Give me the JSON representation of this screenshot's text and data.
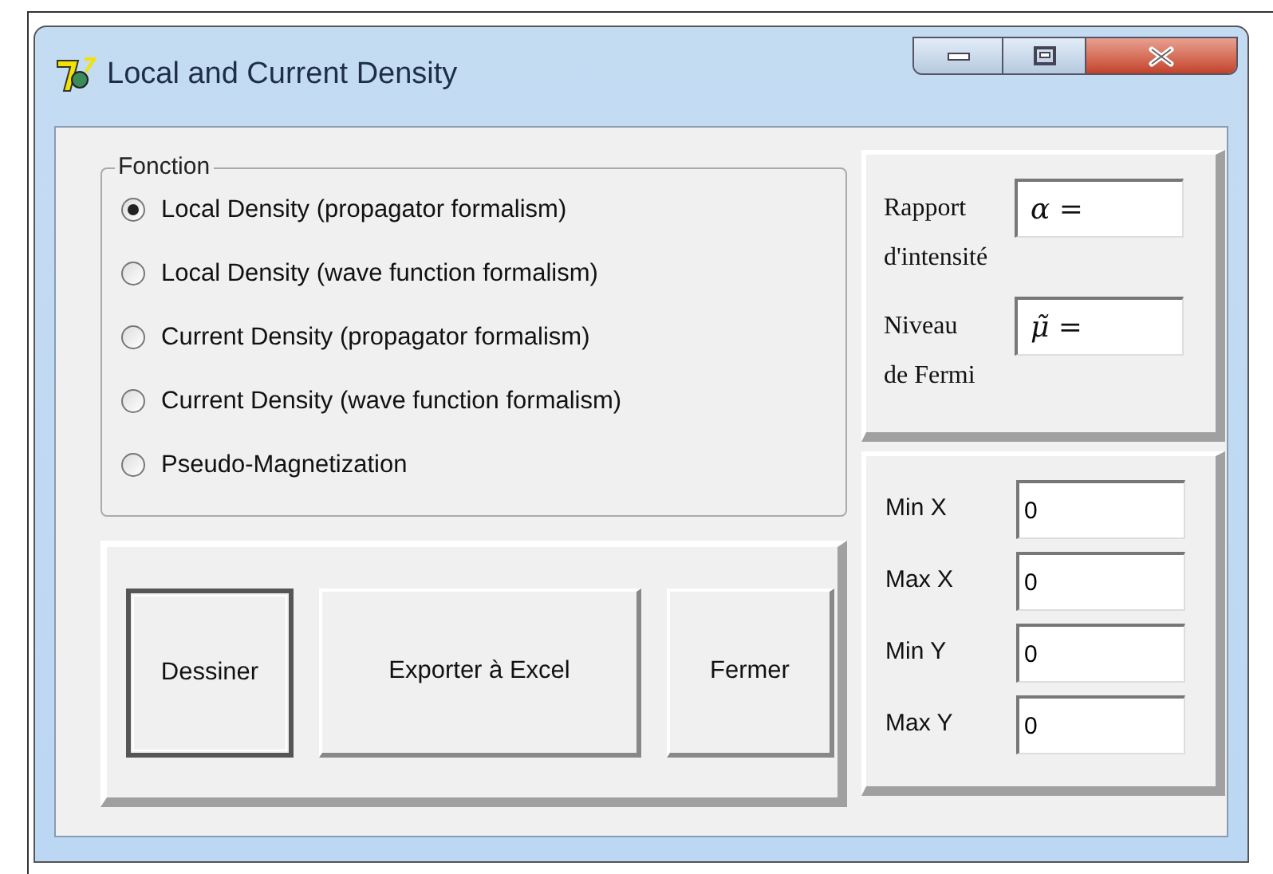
{
  "window": {
    "title": "Local and Current Density"
  },
  "fonction": {
    "legend": "Fonction",
    "options": [
      {
        "label": "Local Density (propagator formalism)",
        "selected": true
      },
      {
        "label": "Local Density (wave function formalism)",
        "selected": false
      },
      {
        "label": "Current Density (propagator formalism)",
        "selected": false
      },
      {
        "label": "Current Density (wave function formalism)",
        "selected": false
      },
      {
        "label": "Pseudo-Magnetization",
        "selected": false
      }
    ]
  },
  "parameters": [
    {
      "label_1": "Rapport",
      "label_2": "d'intensité",
      "value": "α ="
    },
    {
      "label_1": "Niveau",
      "label_2": "de Fermi",
      "value": "μ̃ ="
    }
  ],
  "buttons": [
    {
      "label": "Dessiner",
      "selected": true
    },
    {
      "label": "Exporter à Excel",
      "selected": false
    },
    {
      "label": "Fermer",
      "selected": false
    }
  ],
  "limits": [
    {
      "label": "Min X",
      "value": "0"
    },
    {
      "label": "Max X",
      "value": "0"
    },
    {
      "label": "Min Y",
      "value": "0"
    },
    {
      "label": "Max Y",
      "value": "0"
    }
  ]
}
